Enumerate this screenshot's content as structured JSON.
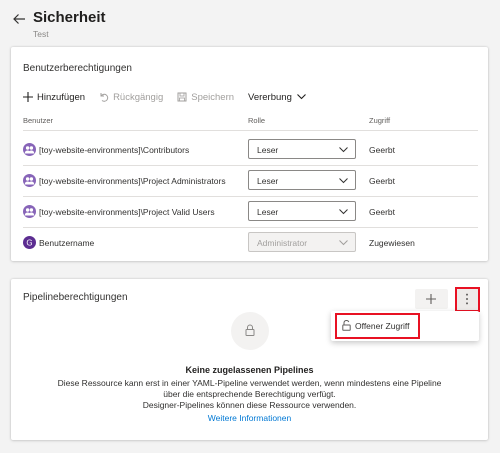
{
  "header": {
    "title": "Sicherheit",
    "subtitle": "Test"
  },
  "user_permissions": {
    "title": "Benutzerberechtigungen",
    "toolbar": {
      "add_label": "Hinzufügen",
      "undo_label": "Rückgängig",
      "save_label": "Speichern",
      "inheritance_label": "Vererbung"
    },
    "columns": {
      "user": "Benutzer",
      "role": "Rolle",
      "access": "Zugriff"
    },
    "rows": [
      {
        "user": "[toy-website-environments]\\Contributors",
        "role": "Leser",
        "access": "Geerbt",
        "avatar": "group-icon",
        "role_enabled": true
      },
      {
        "user": "[toy-website-environments]\\Project Administrators",
        "role": "Leser",
        "access": "Geerbt",
        "avatar": "group-icon",
        "role_enabled": true
      },
      {
        "user": "[toy-website-environments]\\Project Valid Users",
        "role": "Leser",
        "access": "Geerbt",
        "avatar": "group-icon",
        "role_enabled": true
      },
      {
        "user": "Benutzername",
        "role": "Administrator",
        "access": "Zugewiesen",
        "avatar": "user-initial-avatar",
        "avatar_initial": "G",
        "avatar_color": "#5c2d91",
        "role_enabled": false
      }
    ]
  },
  "pipeline_permissions": {
    "title": "Pipelineberechtigungen",
    "menu_item_label": "Offener Zugriff",
    "empty_title": "Keine zugelassenen Pipelines",
    "empty_desc_lines": [
      "Diese Ressource kann erst in einer YAML-Pipeline verwendet werden, wenn mindestens eine Pipeline",
      "über die entsprechende Berechtigung verfügt.",
      "Designer-Pipelines können diese Ressource verwenden."
    ],
    "learn_more": "Weitere Informationen"
  },
  "colors": {
    "accent": "#0078d4",
    "highlight": "#e81123",
    "avatar_purple": "#5c2d91"
  }
}
